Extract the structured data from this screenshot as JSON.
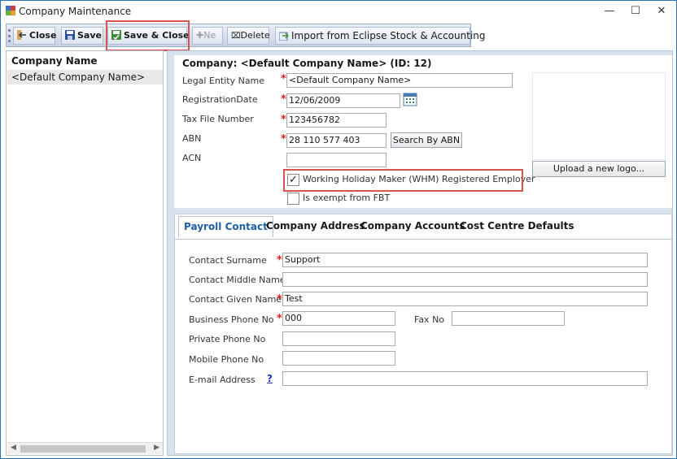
{
  "window": {
    "title": "Company Maintenance",
    "minimize": "—",
    "maximize": "☐",
    "close": "✕"
  },
  "toolbar": {
    "close_label": "Close",
    "save_label": "Save",
    "save_close_label": "Save & Close",
    "new_label": "Ne",
    "delete_label": "Delete",
    "import_label": "Import from Eclipse Stock & Accounting"
  },
  "sidebar": {
    "header": "Company Name",
    "items": [
      {
        "label": "<Default Company Name>"
      }
    ]
  },
  "company": {
    "title": "Company: <Default Company Name> (ID: 12)",
    "fields": {
      "legal_entity_label": "Legal Entity Name",
      "legal_entity_value": "<Default Company Name>",
      "registration_date_label": "RegistrationDate",
      "registration_date_value": "12/06/2009",
      "tax_file_label": "Tax File Number",
      "tax_file_value": "123456782",
      "abn_label": "ABN",
      "abn_value": "28 110 577 403",
      "search_abn": "Search By ABN",
      "acn_label": "ACN",
      "acn_value": "",
      "whm_label": "Working Holiday Maker (WHM) Registered Employer",
      "whm_checked": "✓",
      "fbt_label": "Is exempt from FBT",
      "upload_logo": "Upload a new logo..."
    }
  },
  "tabs": [
    "Payroll Contact",
    "Company Address",
    "Company Accounts",
    "Cost Centre Defaults"
  ],
  "payroll": {
    "surname_label": "Contact Surname",
    "surname_value": "Support",
    "middle_label": "Contact Middle Name",
    "middle_value": "",
    "given_label": "Contact Given Name",
    "given_value": "Test",
    "business_label": "Business Phone No",
    "business_value": "000",
    "fax_label": "Fax No",
    "fax_value": "",
    "private_label": "Private Phone No",
    "private_value": "",
    "mobile_label": "Mobile Phone No",
    "mobile_value": "",
    "email_label": "E-mail Address",
    "email_help": "?",
    "email_value": ""
  },
  "required_mark": "*",
  "colors": {
    "highlight": "#d9534f",
    "required": "#e02020",
    "tab_active": "#1f5fa8"
  }
}
